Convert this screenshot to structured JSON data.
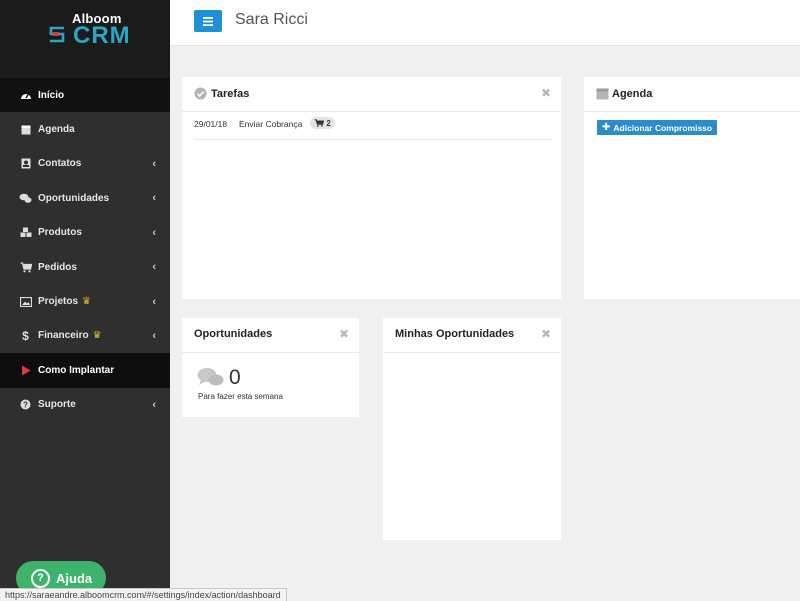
{
  "brand": {
    "top": "Alboom",
    "name": "CRM",
    "accent": "#2aa6c4",
    "mark_color": "#e53935"
  },
  "header": {
    "user_name": "Sara Ricci",
    "toggle_icon": "bars-icon"
  },
  "sidebar": {
    "items": [
      {
        "label": "Início",
        "icon": "dashboard-icon",
        "active": true
      },
      {
        "label": "Agenda",
        "icon": "calendar-icon"
      },
      {
        "label": "Contatos",
        "icon": "contact-card-icon",
        "chevron": "‹"
      },
      {
        "label": "Oportunidades",
        "icon": "chat-bubbles-icon",
        "chevron": "‹"
      },
      {
        "label": "Produtos",
        "icon": "cubes-icon",
        "chevron": "‹"
      },
      {
        "label": "Pedidos",
        "icon": "cart-icon",
        "chevron": "‹"
      },
      {
        "label": "Projetos",
        "icon": "image-icon",
        "crown": "♛",
        "chevron": "‹"
      },
      {
        "label": "Financeiro",
        "icon": "dollar-icon",
        "crown": "♛",
        "chevron": "‹"
      },
      {
        "label": "Como Implantar",
        "icon": "play-icon",
        "highlight": true
      },
      {
        "label": "Suporte",
        "icon": "question-icon",
        "chevron": "‹"
      }
    ]
  },
  "help_button": {
    "label": "Ajuda",
    "icon_glyph": "?"
  },
  "status_url": "https://saraeandre.alboomcrm.com/#/settings/index/action/dashboard",
  "panels": {
    "tarefas": {
      "title": "Tarefas",
      "close": "✖",
      "rows": [
        {
          "date": "29/01/18",
          "title": "Enviar Cobrança",
          "badge": "2"
        }
      ]
    },
    "agenda": {
      "title": "Agenda",
      "add_label": "Adicionar Compromisso"
    },
    "oportunidades": {
      "title": "Oportunidades",
      "close": "✖",
      "count": "0",
      "subtitle": "Para fazer esta semana"
    },
    "minhas": {
      "title": "Minhas Oportunidades",
      "close": "✖"
    }
  }
}
